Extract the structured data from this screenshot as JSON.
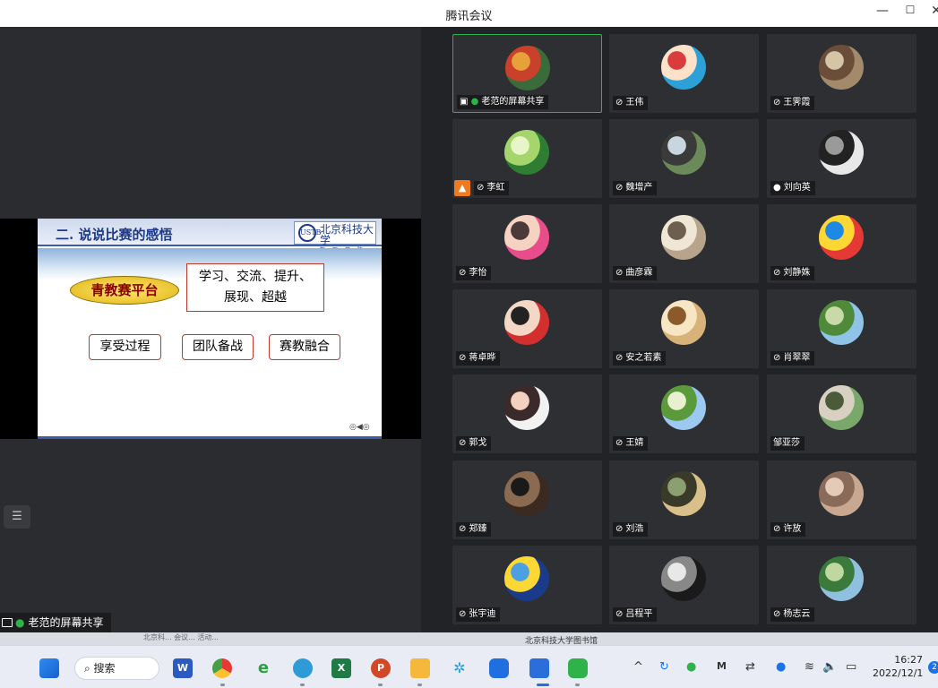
{
  "window": {
    "title": "腾讯会议",
    "minimize": "—",
    "maximize": "☐",
    "close": "✕"
  },
  "slide": {
    "title": "二. 说说比赛的感悟",
    "logo_main": "北京科技大学",
    "logo_sub": "数 理 学 院",
    "logo_emblem": "USTB",
    "pill": "青教赛平台",
    "box_line1": "学习、交流、提升、",
    "box_line2": "展现、超越",
    "buttons": [
      "享受过程",
      "团队备战",
      "赛教融合"
    ],
    "pager": "◎◀◎"
  },
  "left": {
    "list_icon": "☰",
    "share_label": "老范的屏幕共享"
  },
  "participants": [
    {
      "name": "老范的屏幕共享",
      "mic": "on",
      "screen": true,
      "avatar": "bird-of-paradise flower",
      "colors": [
        "#3b6b3a",
        "#c9412b",
        "#e8a13a"
      ]
    },
    {
      "name": "王伟",
      "mic": "muted",
      "avatar": "cartoon girl",
      "colors": [
        "#2ea0d8",
        "#fbe2c8",
        "#d83c3c"
      ]
    },
    {
      "name": "王霁霞",
      "mic": "muted",
      "avatar": "painting",
      "colors": [
        "#a38a6a",
        "#6b4e3a",
        "#d4c4a8"
      ]
    },
    {
      "name": "李虹",
      "mic": "muted",
      "cam": true,
      "avatar": "bamboo",
      "colors": [
        "#2f7d32",
        "#a5d66b",
        "#e8f5c8"
      ]
    },
    {
      "name": "魏增产",
      "mic": "muted",
      "avatar": "man outdoors",
      "colors": [
        "#6a8a5a",
        "#3a3a3a",
        "#c8d6e0"
      ]
    },
    {
      "name": "刘向英",
      "mic": "on-white",
      "avatar": "ink painting",
      "colors": [
        "#e8e8e8",
        "#222",
        "#9a9a9a"
      ]
    },
    {
      "name": "李怡",
      "mic": "muted",
      "avatar": "two girls",
      "colors": [
        "#e84c8a",
        "#f6d2c2",
        "#4a3a3a"
      ]
    },
    {
      "name": "曲彦霖",
      "mic": "muted",
      "avatar": "cat",
      "colors": [
        "#b7a48a",
        "#f0e6d6",
        "#6d5f50"
      ]
    },
    {
      "name": "刘静姝",
      "mic": "muted",
      "avatar": "rainbow spiral",
      "colors": [
        "#e53935",
        "#fdd835",
        "#1e88e5"
      ]
    },
    {
      "name": "蒋卓晔",
      "mic": "muted",
      "avatar": "woman in red",
      "colors": [
        "#d32f2f",
        "#f5d7c5",
        "#222"
      ]
    },
    {
      "name": "安之若素",
      "mic": "muted",
      "avatar": "girl reading",
      "colors": [
        "#d9b27a",
        "#f7e6c4",
        "#8a5a2a"
      ]
    },
    {
      "name": "肖翠翠",
      "mic": "muted",
      "avatar": "country road",
      "colors": [
        "#8fc3e8",
        "#4f8a3a",
        "#c9d9a8"
      ]
    },
    {
      "name": "郭戈",
      "mic": "muted",
      "avatar": "woman portrait",
      "colors": [
        "#f2f2f2",
        "#3a2a2a",
        "#f3d0c0"
      ]
    },
    {
      "name": "王婧",
      "mic": "muted",
      "avatar": "green hills",
      "colors": [
        "#9cc9ef",
        "#5a9a3a",
        "#e8f0d0"
      ]
    },
    {
      "name": "邹亚莎",
      "mic": "none",
      "avatar": "kitten",
      "colors": [
        "#7aa86a",
        "#d8d0c0",
        "#4a5a3a"
      ]
    },
    {
      "name": "郑臻",
      "mic": "muted",
      "avatar": "man in suit",
      "colors": [
        "#3a2a20",
        "#8a6a50",
        "#1a1a1a"
      ]
    },
    {
      "name": "刘浩",
      "mic": "muted",
      "avatar": "cat outdoors",
      "colors": [
        "#d9c08a",
        "#3a3a2a",
        "#8aa070"
      ]
    },
    {
      "name": "许放",
      "mic": "muted",
      "avatar": "stone carving",
      "colors": [
        "#c8a890",
        "#8a6a58",
        "#e4cbb8"
      ]
    },
    {
      "name": "张宇迪",
      "mic": "muted",
      "avatar": "starry night",
      "colors": [
        "#1a3a8a",
        "#fdd835",
        "#4aa0e0"
      ]
    },
    {
      "name": "吕程平",
      "mic": "muted",
      "avatar": "tunnel",
      "colors": [
        "#1a1a1a",
        "#888",
        "#e8e8e8"
      ]
    },
    {
      "name": "杨志云",
      "mic": "muted",
      "avatar": "mountain valley",
      "colors": [
        "#8fc0e0",
        "#3a7a3a",
        "#c0d8a0"
      ]
    }
  ],
  "behind": {
    "left_text": "北京科... 会议... 活动...",
    "right_text": "北京科技大学图书馆"
  },
  "taskbar": {
    "search_label": "搜索",
    "clock_time": "16:27",
    "clock_date": "2022/12/1",
    "notification_count": "2",
    "tray": {
      "chevron": "^",
      "sound": "🔈",
      "wifi": "≋"
    }
  }
}
